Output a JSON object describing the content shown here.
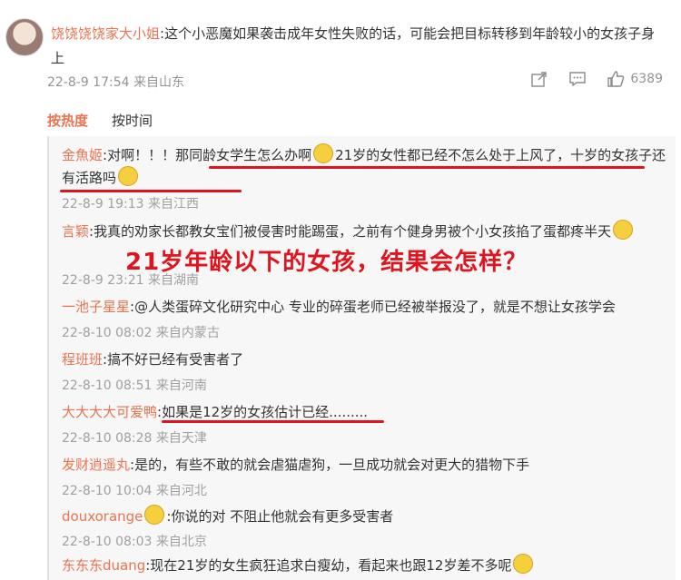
{
  "post": {
    "username": "饶饶饶饶家大小姐",
    "text": ":这个小恶魔如果袭击成年女性失败的话，可能会把目标转移到年龄较小的女孩子身上",
    "timestamp": "22-8-9 17:54 来自山东",
    "like_count": "6389"
  },
  "sort": {
    "hot": "按热度",
    "time": "按时间"
  },
  "overlay_text": "21岁年龄以下的女孩，结果会怎样？",
  "replies": [
    {
      "user": "金魚姬",
      "text_a": ":对啊！！！那同龄女学生怎么办啊",
      "text_b": "21岁的女性都已经不怎么处于上风了，十岁的女孩子还有活路吗",
      "time": "22-8-9 19:13 来自江西"
    },
    {
      "user": "言颖",
      "text": ":我真的劝家长都教女宝们被侵害时能踢蛋，之前有个健身男被个小女孩掐了蛋都疼半天",
      "time": "22-8-9 23:21 来自湖南"
    },
    {
      "user": "一池子星星",
      "text": ":@人类蛋碎文化研究中心 专业的碎蛋老师已经被举报没了，就是不想让女孩学会",
      "time": "22-8-10 08:02 来自内蒙古"
    },
    {
      "user": "程班班",
      "text": ":搞不好已经有受害者了",
      "time": "22-8-10 08:51 来自河南"
    },
    {
      "user": "大大大大可爱鸭",
      "text": ":如果是12岁的女孩估计已经.........",
      "time": "22-8-10 08:28 来自天津"
    },
    {
      "user": "发财逍遥丸",
      "text": ":是的，有些不敢的就会虐猫虐狗，一旦成功就会对更大的猎物下手",
      "time": "22-8-10 10:04 来自河北"
    },
    {
      "user": "douxorange",
      "text": ":你说的对 不阻止他就会有更多受害者",
      "time": "22-8-10 08:03 来自北京"
    },
    {
      "user": "东东东duang",
      "text": ":现在21岁的女生疯狂追求白瘦幼，看起来也跟12岁差不多呢",
      "time": ""
    }
  ],
  "colors": {
    "accent": "#eb7350",
    "annotation_red": "#e0141e"
  },
  "icons": [
    "share-icon",
    "comment-icon",
    "like-icon",
    "emoji-icon"
  ]
}
